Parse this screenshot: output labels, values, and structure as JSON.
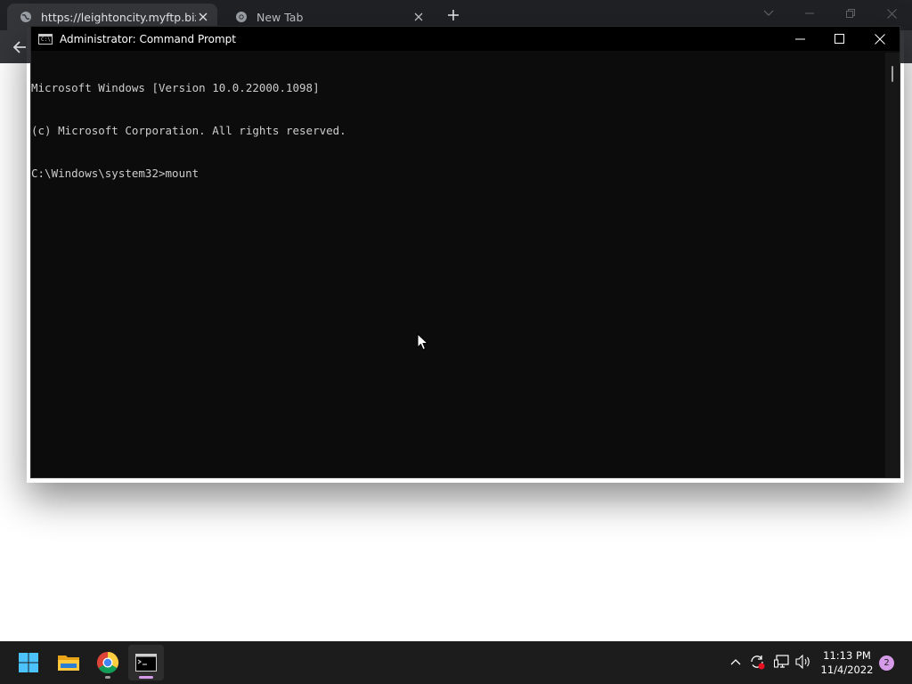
{
  "browser": {
    "tabs": [
      {
        "title": "https://leightoncity.myftp.biz/ad",
        "icon": "globe-icon"
      },
      {
        "title": "New Tab",
        "icon": "chrome-icon"
      }
    ]
  },
  "cmd": {
    "title": "Administrator: Command Prompt",
    "lines": [
      "Microsoft Windows [Version 10.0.22000.1098]",
      "(c) Microsoft Corporation. All rights reserved.",
      "C:\\Windows\\system32>mount"
    ]
  },
  "taskbar": {
    "apps": [
      "windows-start-icon",
      "file-explorer-icon",
      "chrome-icon",
      "terminal-icon"
    ],
    "clock": {
      "time": "11:13 PM",
      "date": "11/4/2022"
    },
    "notifications": "2"
  },
  "colors": {
    "accent": "#d59be8",
    "cmd_bg": "#0c0c0c",
    "tab_bar": "#202124"
  }
}
